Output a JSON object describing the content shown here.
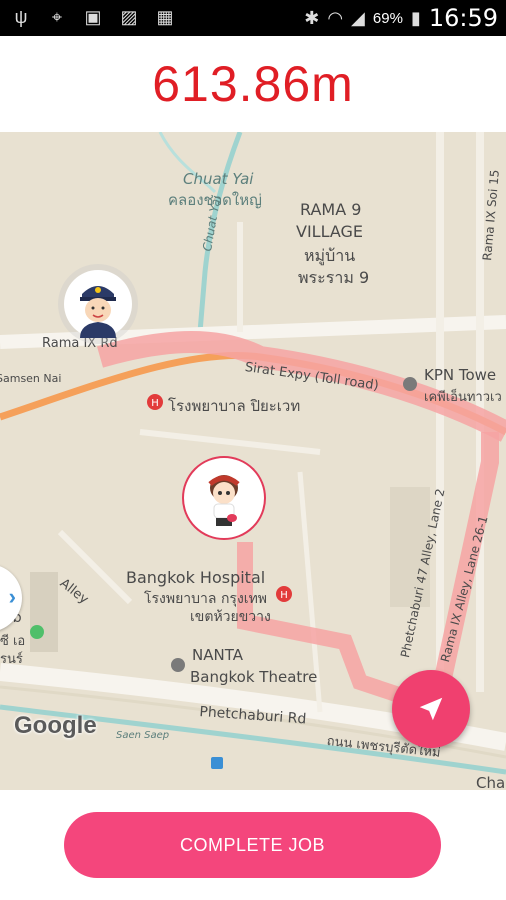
{
  "status_bar": {
    "battery_percent": "69%",
    "time": "16:59",
    "icons": [
      "usb-icon",
      "gps-icon",
      "sim-off-icon",
      "image-icon",
      "app-icon",
      "bluetooth-icon",
      "wifi-icon",
      "signal-icon",
      "battery-charging-icon"
    ]
  },
  "header": {
    "distance": "613.86m"
  },
  "map": {
    "labels": {
      "chuat_yai_en": "Chuat Yai",
      "chuat_yai_th": "คลองชวดใหญ่",
      "chuat_yai_vertical": "Chuat Yai",
      "rama9_village_1": "RAMA 9",
      "rama9_village_2": "VILLAGE",
      "rama9_village_3": "หมู่บ้าน",
      "rama9_village_4": "พระราม 9",
      "rama9_soi15": "Rama IX Soi 15",
      "rama9_rd": "Rama IX Rd",
      "samsen_nai": "Samsen Nai",
      "sirat_expy": "Sirat Expy (Toll road)",
      "kpn_tower_en": "KPN Towe",
      "kpn_tower_th": "เคพีเอ็นทาวเว",
      "hospital_piyavate": "โรงพยาบาล ปิยะเวท",
      "bangkok_hospital_en": "Bangkok Hospital",
      "bangkok_hospital_th1": "โรงพยาบาล กรุงเทพ",
      "bangkok_hospital_th2": "เขตห้วยขวาง",
      "alley": "Alley",
      "phetchaburi47": "Phetchaburi 47 Alley, Lane 2",
      "rama9_alley": "Rama IX Alley, Lane 26-1",
      "nanta_1": "NANTA",
      "nanta_2": "Bangkok Theatre",
      "club": "lub",
      "club_th1": "ซี เอ",
      "club_th2": "รนร์",
      "phetchaburi_rd": "Phetchaburi Rd",
      "saen_saep": "Saen Saep",
      "phetchaburi_th": "ถนน เพชรบุรีตัดใหม่",
      "cha": "Cha",
      "google": "Google"
    },
    "colors": {
      "route": "#f6a3a3",
      "expressway": "#f5a05a",
      "canal": "#9fd3cf",
      "accent": "#f4467c"
    }
  },
  "buttons": {
    "complete_job": "COMPLETE JOB"
  }
}
